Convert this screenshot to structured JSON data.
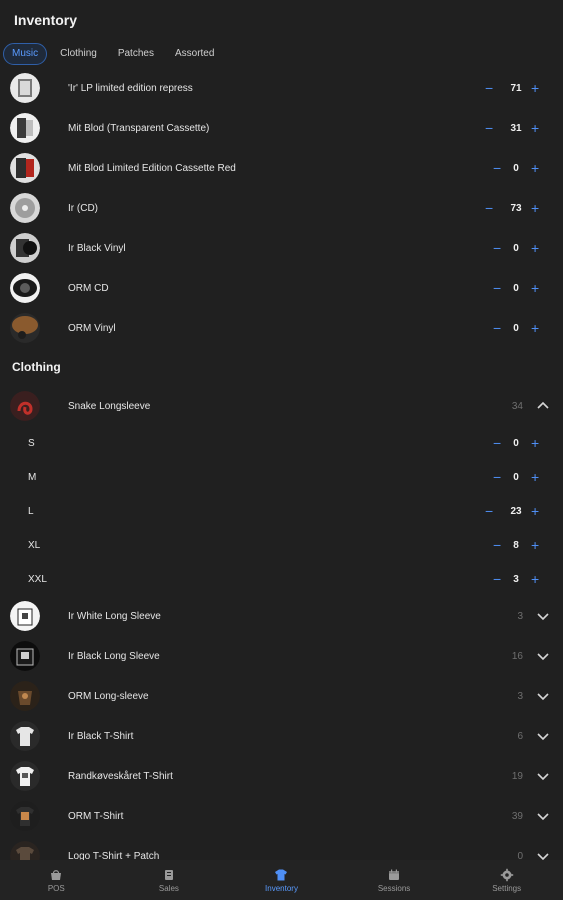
{
  "header": {
    "title": "Inventory"
  },
  "tabs": [
    {
      "label": "Music",
      "active": true
    },
    {
      "label": "Clothing",
      "active": false
    },
    {
      "label": "Patches",
      "active": false
    },
    {
      "label": "Assorted",
      "active": false
    }
  ],
  "music": [
    {
      "name": "'Ir' LP limited edition repress",
      "count": "71"
    },
    {
      "name": "Mit Blod (Transparent Cassette)",
      "count": "31"
    },
    {
      "name": "Mit Blod Limited Edition Cassette Red",
      "count": "0"
    },
    {
      "name": "Ir (CD)",
      "count": "73"
    },
    {
      "name": "Ir Black Vinyl",
      "count": "0"
    },
    {
      "name": "ORM CD",
      "count": "0"
    },
    {
      "name": "ORM Vinyl",
      "count": "0"
    }
  ],
  "clothing_section": {
    "title": "Clothing",
    "expanded_item": {
      "name": "Snake Longsleeve",
      "total": "34",
      "variants": [
        {
          "label": "S",
          "count": "0"
        },
        {
          "label": "M",
          "count": "0"
        },
        {
          "label": "L",
          "count": "23"
        },
        {
          "label": "XL",
          "count": "8"
        },
        {
          "label": "XXL",
          "count": "3"
        }
      ]
    },
    "items": [
      {
        "name": "Ir White Long Sleeve",
        "total": "3"
      },
      {
        "name": "Ir Black Long Sleeve",
        "total": "16"
      },
      {
        "name": "ORM Long-sleeve",
        "total": "3"
      },
      {
        "name": "Ir Black T-Shirt",
        "total": "6"
      },
      {
        "name": "Randkøveskåret T-Shirt",
        "total": "19"
      },
      {
        "name": "ORM T-Shirt",
        "total": "39"
      },
      {
        "name": "Logo T-Shirt + Patch",
        "total": "0"
      }
    ]
  },
  "controls": {
    "minus": "−",
    "plus": "+"
  },
  "bottom_nav": [
    {
      "label": "POS",
      "icon": "shop-icon",
      "active": false
    },
    {
      "label": "Sales",
      "icon": "receipt-icon",
      "active": false
    },
    {
      "label": "Inventory",
      "icon": "shirt-icon",
      "active": true
    },
    {
      "label": "Sessions",
      "icon": "calendar-icon",
      "active": false
    },
    {
      "label": "Settings",
      "icon": "gear-icon",
      "active": false
    }
  ],
  "colors": {
    "background": "#202020",
    "accent": "#4f8ff5",
    "text": "#e8e8e8",
    "muted": "#6f6f6f"
  }
}
